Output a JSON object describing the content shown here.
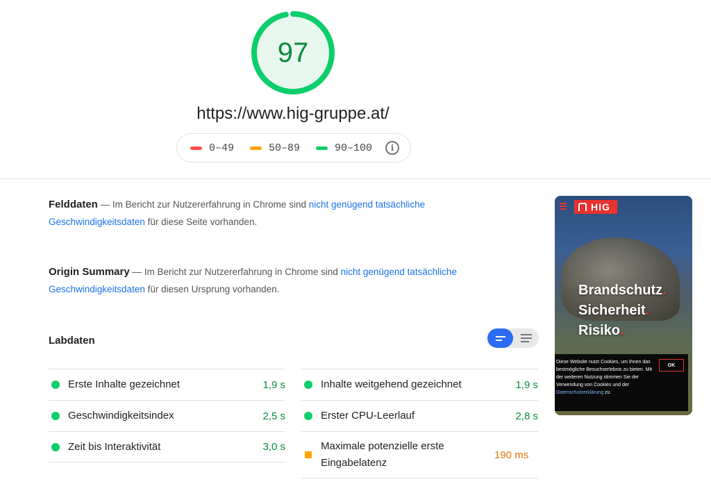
{
  "score": {
    "value": "97",
    "fraction": 0.97,
    "color": "#0cce6b",
    "bg": "#e8f8ef"
  },
  "url": "https://www.hig-gruppe.at/",
  "legend": [
    {
      "label": "0–49",
      "color": "#ff4e42"
    },
    {
      "label": "50–89",
      "color": "#ffa400"
    },
    {
      "label": "90–100",
      "color": "#0cce6b"
    }
  ],
  "field_data": {
    "title": "Felddaten",
    "before": " — Im Bericht zur Nutzererfahrung in Chrome sind ",
    "link": "nicht genügend tatsächliche Geschwindigkeitsdaten",
    "after": " für diese Seite vorhanden."
  },
  "origin_summary": {
    "title": "Origin Summary",
    "before": " — Im Bericht zur Nutzererfahrung in Chrome sind ",
    "link": "nicht genügend tatsächliche Geschwindigkeitsdaten",
    "after": " für diesen Ursprung vorhanden."
  },
  "lab_data": {
    "title": "Labdaten",
    "left": [
      {
        "label": "Erste Inhalte gezeichnet",
        "value": "1,9 s",
        "rating": "pass"
      },
      {
        "label": "Geschwindigkeitsindex",
        "value": "2,5 s",
        "rating": "pass"
      },
      {
        "label": "Zeit bis Interaktivität",
        "value": "3,0 s",
        "rating": "pass"
      }
    ],
    "right": [
      {
        "label": "Inhalte weitgehend gezeichnet",
        "value": "1,9 s",
        "rating": "pass"
      },
      {
        "label": "Erster CPU-Leerlauf",
        "value": "2,8 s",
        "rating": "pass"
      },
      {
        "label": "Maximale potenzielle erste Eingabelatenz",
        "value": "190 ms",
        "rating": "average"
      }
    ]
  },
  "thumbnail": {
    "logo": "HIG",
    "headline": [
      "Brandschutz",
      "Sicherheit",
      "Risiko"
    ],
    "cookie_text": "Diese Website nutzt Cookies, um Ihnen das bestmögliche Besuchserlebnis zu bieten. Mit der weiteren Nutzung stimmen Sie der Verwendung von Cookies und der ",
    "cookie_link": "Datenschutzerklärung",
    "cookie_after": " zu.",
    "ok_label": "OK"
  },
  "colors": {
    "pass": "#0cce6b",
    "average": "#ffa400",
    "fail": "#ff4e42",
    "link": "#1a73e8",
    "toggle_active": "#2b6cf3"
  }
}
